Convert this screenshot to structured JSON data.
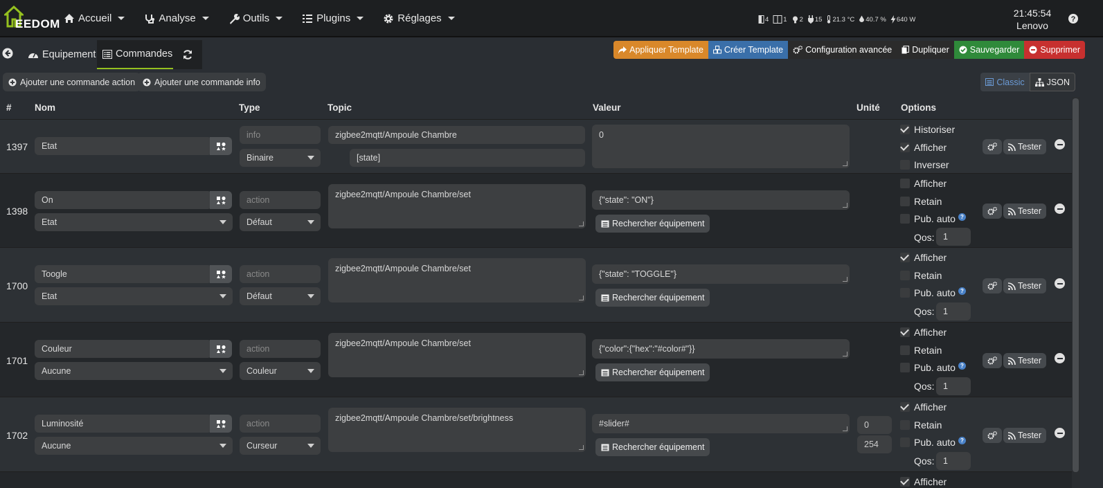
{
  "navbar": {
    "logo_text": "EEDOM",
    "menu": [
      {
        "label": "Accueil",
        "icon": "home-icon"
      },
      {
        "label": "Analyse",
        "icon": "stethoscope-icon"
      },
      {
        "label": "Outils",
        "icon": "wrench-icon"
      },
      {
        "label": "Plugins",
        "icon": "list-icon"
      },
      {
        "label": "Réglages",
        "icon": "gear-icon"
      }
    ],
    "status": {
      "doors": "4",
      "windows": "1",
      "lights": "2",
      "plugs": "15",
      "temperature": "21.3 °C",
      "humidity": "40.7 %",
      "power": "640 W"
    },
    "clock": {
      "time": "21:45:54",
      "host": "Lenovo"
    }
  },
  "tabs": {
    "equipment": "Equipement",
    "commands": "Commandes"
  },
  "actions": {
    "apply_template": "Appliquer Template",
    "create_template": "Créer Template",
    "advanced_config": "Configuration avancée",
    "duplicate": "Dupliquer",
    "save": "Sauvegarder",
    "delete": "Supprimer"
  },
  "toolbar": {
    "add_action": "Ajouter une commande action",
    "add_info": "Ajouter une commande info",
    "classic": "Classic",
    "json": "JSON"
  },
  "table": {
    "headers": {
      "id": "#",
      "name": "Nom",
      "type": "Type",
      "topic": "Topic",
      "value": "Valeur",
      "unit": "Unité",
      "options": "Options"
    },
    "search_label": "Rechercher équipement",
    "test_label": "Tester",
    "qos_label": "Qos:",
    "rows": [
      {
        "id": "1397",
        "name": "Etat",
        "type": "info",
        "subtype": "Binaire",
        "topic": "zigbee2mqtt/Ampoule Chambre",
        "topic_key": "[state]",
        "value": "0",
        "options": [
          {
            "label": "Historiser",
            "checked": true
          },
          {
            "label": "Afficher",
            "checked": true
          },
          {
            "label": "Inverser",
            "checked": false
          }
        ]
      },
      {
        "id": "1398",
        "name": "On",
        "link": "Etat",
        "type": "action",
        "subtype": "Défaut",
        "topic": "zigbee2mqtt/Ampoule Chambre/set",
        "value": "{\"state\": \"ON\"}",
        "options": [
          {
            "label": "Afficher",
            "checked": false
          },
          {
            "label": "Retain",
            "checked": false
          },
          {
            "label": "Pub. auto",
            "checked": false
          }
        ],
        "qos": "1"
      },
      {
        "id": "1700",
        "name": "Toogle",
        "link": "Etat",
        "type": "action",
        "subtype": "Défaut",
        "topic": "zigbee2mqtt/Ampoule Chambre/set",
        "value": "{\"state\": \"TOGGLE\"}",
        "options": [
          {
            "label": "Afficher",
            "checked": true
          },
          {
            "label": "Retain",
            "checked": false
          },
          {
            "label": "Pub. auto",
            "checked": false
          }
        ],
        "qos": "1"
      },
      {
        "id": "1701",
        "name": "Couleur",
        "link": "Aucune",
        "type": "action",
        "subtype": "Couleur",
        "topic": "zigbee2mqtt/Ampoule Chambre/set",
        "value": "{\"color\":{\"hex\":\"#color#\"}}",
        "options": [
          {
            "label": "Afficher",
            "checked": true
          },
          {
            "label": "Retain",
            "checked": false
          },
          {
            "label": "Pub. auto",
            "checked": false
          }
        ],
        "qos": "1"
      },
      {
        "id": "1702",
        "name": "Luminosité",
        "link": "Aucune",
        "type": "action",
        "subtype": "Curseur",
        "topic": "zigbee2mqtt/Ampoule Chambre/set/brightness",
        "value": "#slider#",
        "unit_min": "0",
        "unit_max": "254",
        "options": [
          {
            "label": "Afficher",
            "checked": true
          },
          {
            "label": "Retain",
            "checked": false
          },
          {
            "label": "Pub. auto",
            "checked": false
          }
        ],
        "qos": "1"
      }
    ],
    "next_row_option": "Afficher"
  },
  "colors": {
    "accent": "#95c11f",
    "template": "#d9882a",
    "create": "#3a6fa9",
    "save": "#2f8a3a",
    "delete": "#c7302f"
  }
}
